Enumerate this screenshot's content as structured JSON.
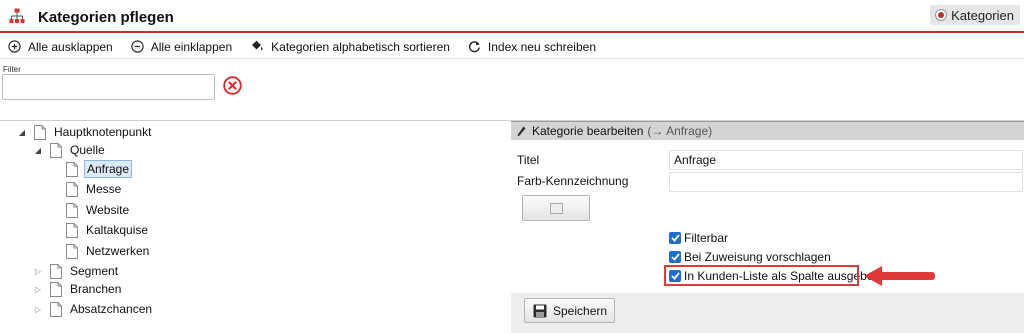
{
  "header": {
    "title": "Kategorien pflegen",
    "app_icon": "sitemap-icon",
    "context_badge": "Kategorien"
  },
  "toolbar": {
    "expand_all": "Alle ausklappen",
    "collapse_all": "Alle einklappen",
    "sort_alpha": "Kategorien alphabetisch sortieren",
    "rebuild_index": "Index neu schreiben"
  },
  "filter": {
    "label": "Filter",
    "value": "",
    "placeholder": ""
  },
  "tree": {
    "root": "Hauptknotenpunkt",
    "source": "Quelle",
    "source_children": [
      "Anfrage",
      "Messe",
      "Website",
      "Kaltakquise",
      "Netzwerken"
    ],
    "segment": "Segment",
    "industries": "Branchen",
    "sales_chances": "Absatzchancen"
  },
  "panel": {
    "heading": "Kategorie bearbeiten",
    "heading_ref": "(→ Anfrage)",
    "title_label": "Titel",
    "title_value": "Anfrage",
    "color_label": "Farb-Kennzeichnung",
    "color_value": "",
    "check_filterable": "Filterbar",
    "check_suggest": "Bei Zuweisung vorschlagen",
    "check_column": "In Kunden-Liste als Spalte ausgeben",
    "save": "Speichern"
  },
  "colors": {
    "accent_red": "#c0312b",
    "highlight_red": "#e0393a",
    "checkbox_blue": "#1c6fd1",
    "selection_bg": "#dbeaf7"
  }
}
